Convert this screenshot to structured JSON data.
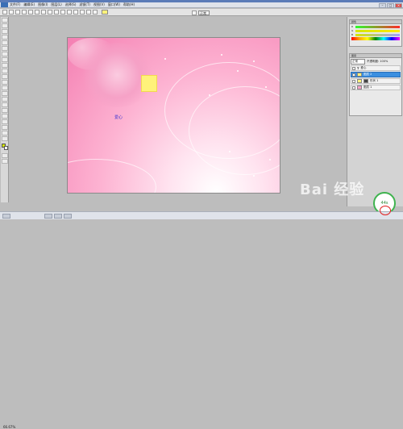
{
  "app": {
    "title": "Photoshop"
  },
  "menu": [
    "文件(F)",
    "编辑(E)",
    "图像(I)",
    "图层(L)",
    "选择(S)",
    "滤镜(T)",
    "视图(V)",
    "窗口(W)",
    "帮助(H)"
  ],
  "options": {
    "mode_label": "正常",
    "mode_value": "正常",
    "swatch_color": "#fff27a"
  },
  "toolbox": {
    "fg_color": "#d4e600",
    "bg_color": "#ffffff"
  },
  "canvas": {
    "text_layer": "爱心",
    "yellow_color": "#fff27a"
  },
  "color_panel": {
    "tab": "颜色",
    "rows": [
      "R",
      "G",
      "B"
    ]
  },
  "layers_panel": {
    "tab": "图层",
    "blend_mode": "正常",
    "opacity_label": "不透明度: 100%",
    "layers": [
      {
        "name": "爱心",
        "selected": false
      },
      {
        "name": "图层 2",
        "selected": true
      },
      {
        "name": "形状 1",
        "selected": false
      },
      {
        "name": "图层 1",
        "selected": false
      }
    ]
  },
  "status": {
    "zoom": "66.67%"
  },
  "watermark": {
    "text": "Bai 经验",
    "badge": "44s"
  }
}
